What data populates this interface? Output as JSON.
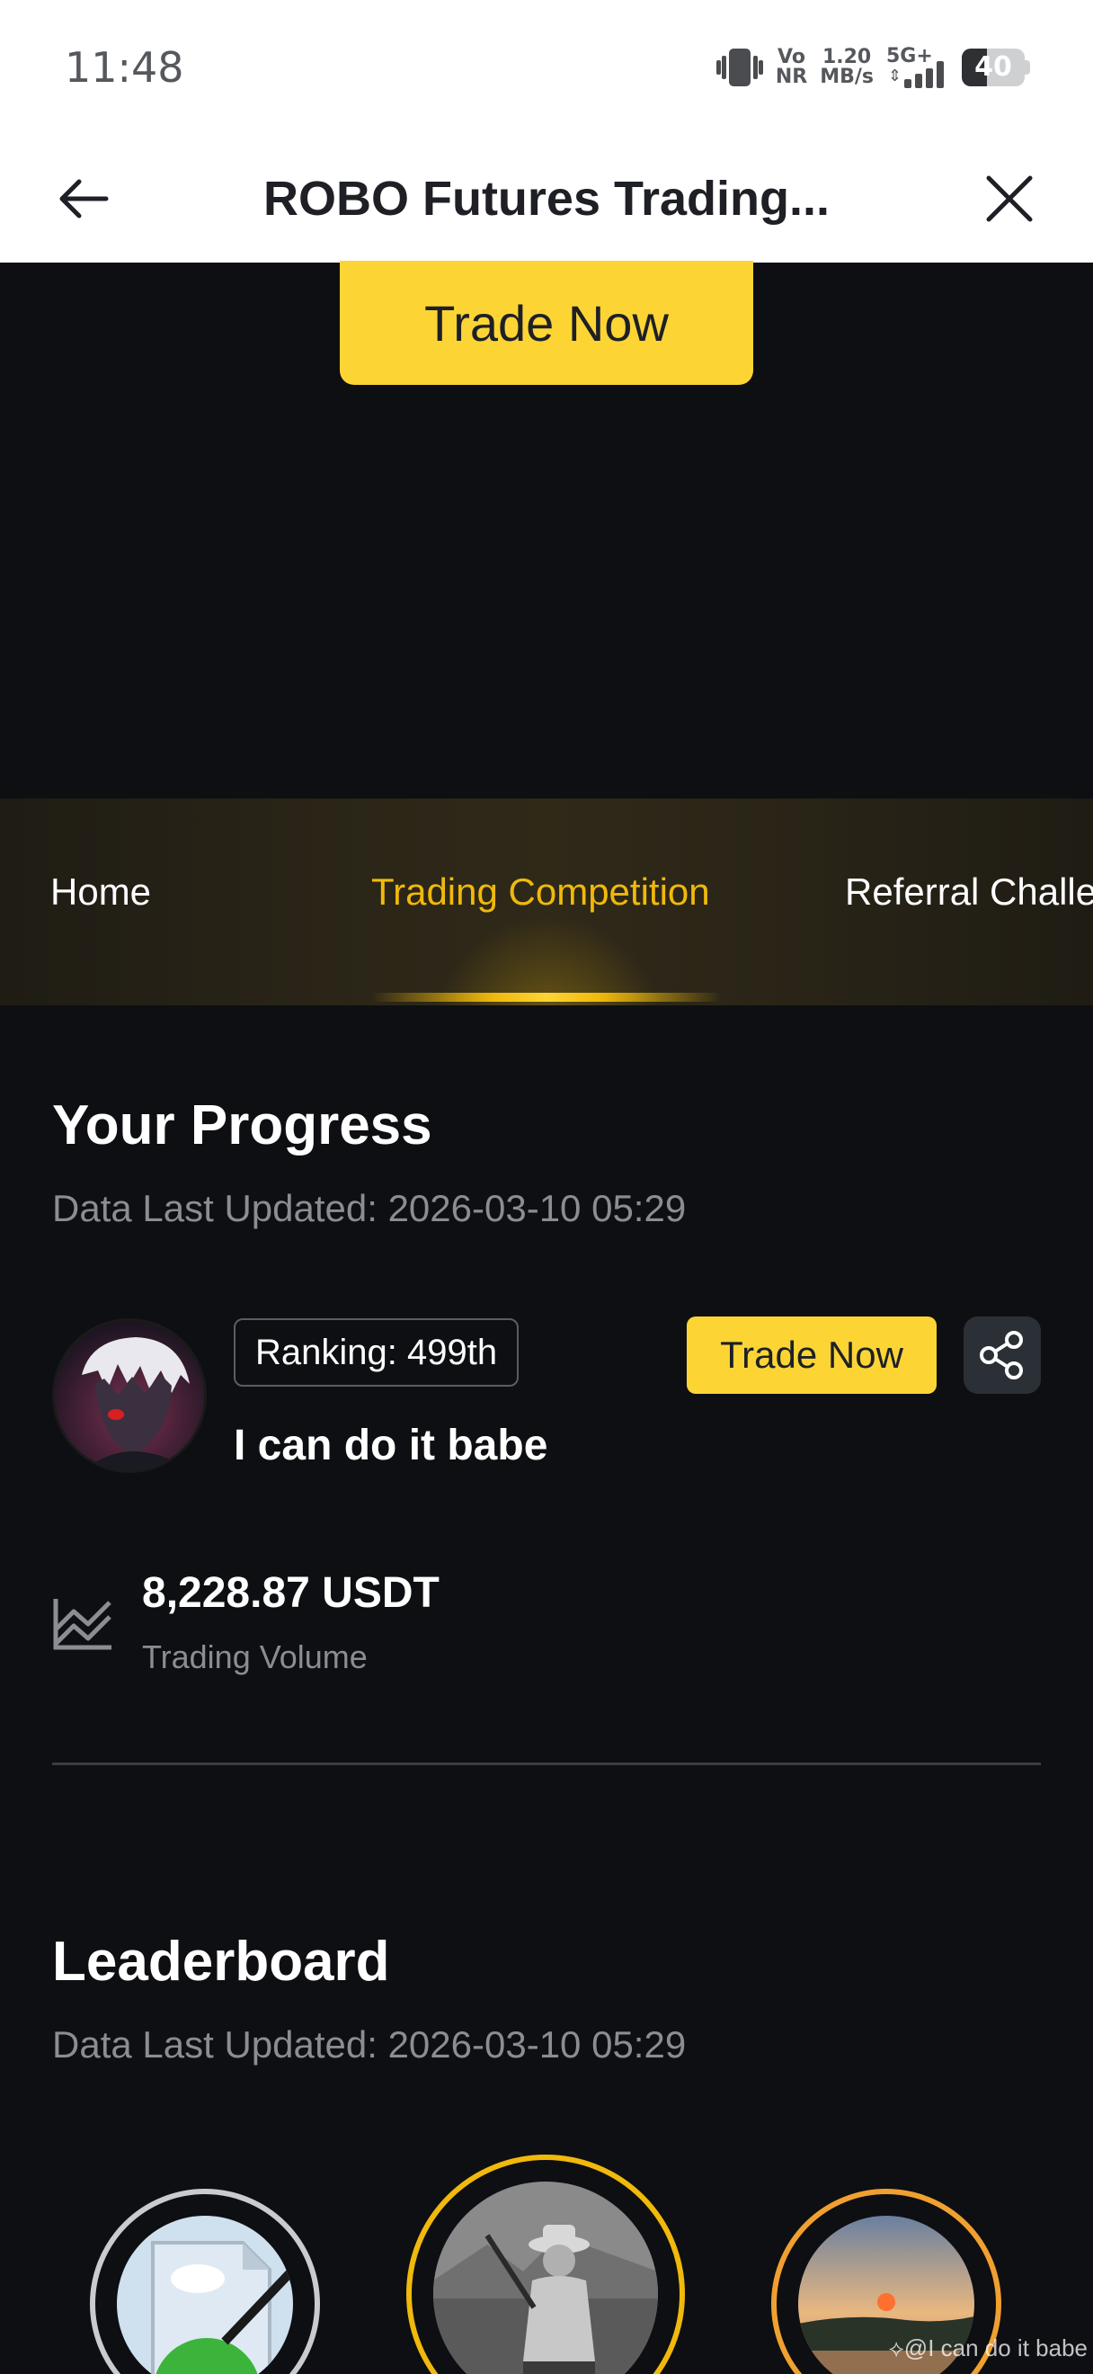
{
  "status_bar": {
    "time": "11:48",
    "volte_top": "Vo",
    "volte_bottom": "NR",
    "speed_top": "1.20",
    "speed_bottom": "MB/s",
    "network": "5G+",
    "battery": "40",
    "battery_level": 0.4
  },
  "header": {
    "title": "ROBO Futures Trading..."
  },
  "top_button": {
    "label": "Trade Now"
  },
  "tabs": [
    {
      "label": "Home"
    },
    {
      "label": "Trading Competition"
    },
    {
      "label": "Referral Challe"
    }
  ],
  "progress": {
    "title": "Your Progress",
    "updated": "Data Last Updated: 2026-03-10 05:29",
    "ranking": "Ranking: 499th",
    "username": "I can do it babe",
    "trade_button": "Trade Now",
    "volume_value": "8,228.87 USDT",
    "volume_label": "Trading Volume"
  },
  "leaderboard": {
    "title": "Leaderboard",
    "updated": "Data Last Updated: 2026-03-10 05:29"
  },
  "watermark": "@I can do it babe",
  "colors": {
    "accent": "#fcd535",
    "background": "#0e0f12",
    "tab_active": "#f0b90b"
  }
}
